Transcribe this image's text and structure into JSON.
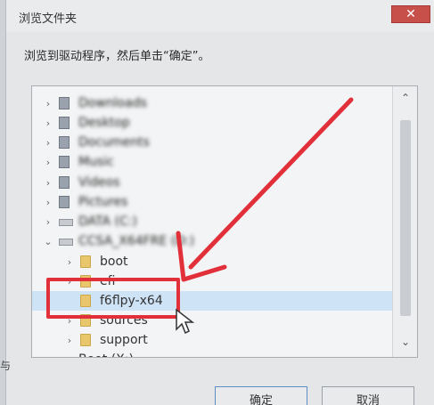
{
  "dialog": {
    "title": "浏览文件夹",
    "instruction": "浏览到驱动程序，然后单击“确定”。",
    "close_label": "✕"
  },
  "tree": {
    "items": [
      {
        "label": "Downloads",
        "icon": "download-folder-icon",
        "expander": "›",
        "blurred": true
      },
      {
        "label": "Desktop",
        "icon": "desktop-folder-icon",
        "expander": "›",
        "blurred": true
      },
      {
        "label": "Documents",
        "icon": "documents-folder-icon",
        "expander": "›",
        "blurred": true
      },
      {
        "label": "Music",
        "icon": "music-folder-icon",
        "expander": "›",
        "blurred": true
      },
      {
        "label": "Videos",
        "icon": "videos-folder-icon",
        "expander": "›",
        "blurred": true
      },
      {
        "label": "Pictures",
        "icon": "pictures-folder-icon",
        "expander": "›",
        "blurred": true
      },
      {
        "label": "DATA (C:)",
        "icon": "drive-icon",
        "expander": "›",
        "blurred": true
      },
      {
        "label": "CCSA_X64FRE (D:)",
        "icon": "drive-icon",
        "expander": "⌄",
        "blurred": true
      },
      {
        "label": "boot",
        "icon": "folder-icon",
        "expander": "›",
        "blurred": false
      },
      {
        "label": "efi",
        "icon": "folder-icon",
        "expander": "›",
        "blurred": false
      },
      {
        "label": "f6flpy-x64",
        "icon": "folder-icon",
        "expander": "",
        "blurred": false,
        "selected": true
      },
      {
        "label": "sources",
        "icon": "folder-icon",
        "expander": "›",
        "blurred": false
      },
      {
        "label": "support",
        "icon": "folder-icon",
        "expander": "›",
        "blurred": false
      },
      {
        "label": "Boot (X:)",
        "icon": "drive-icon",
        "expander": "›",
        "blurred": false
      }
    ]
  },
  "scrollbar": {
    "up": "⌃",
    "down": "⌄"
  },
  "buttons": {
    "ok": "确定",
    "cancel": "取消"
  },
  "side_text": "与",
  "colors": {
    "annotation": "#e2303a",
    "selection": "#cfe3f7"
  }
}
